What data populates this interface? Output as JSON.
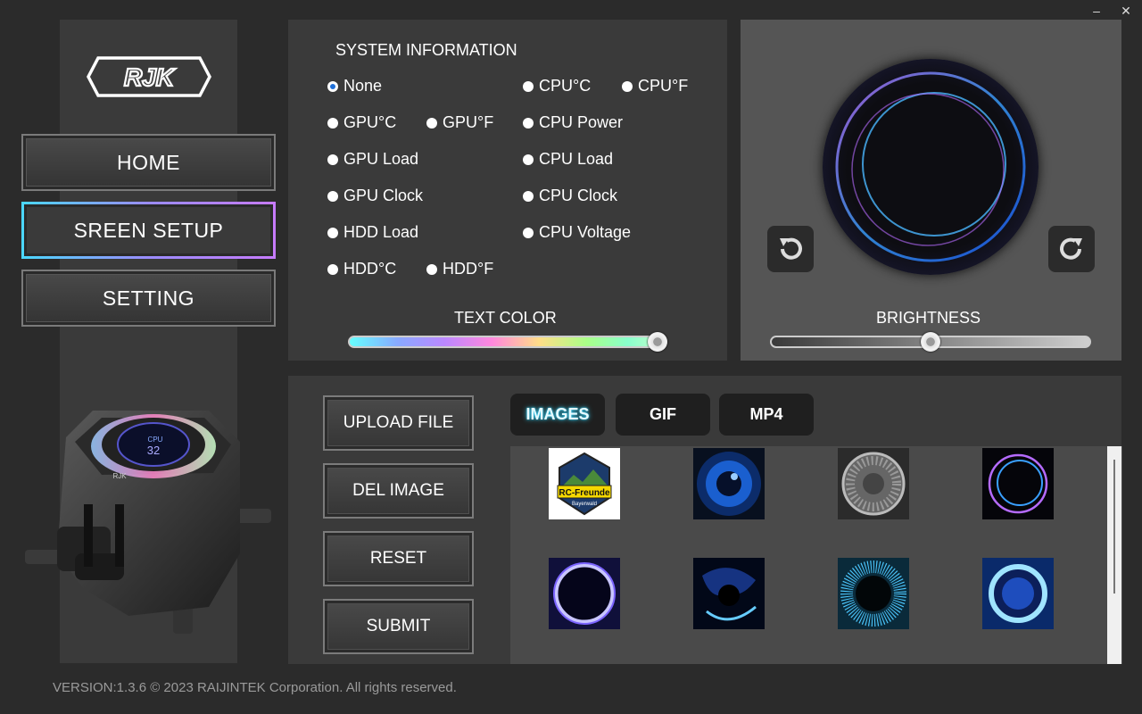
{
  "window": {
    "minimize_label": "–",
    "close_label": "✕"
  },
  "brand": {
    "logo_text": "RJK"
  },
  "nav": [
    {
      "label": "HOME"
    },
    {
      "label": "SREEN  SETUP"
    },
    {
      "label": "SETTING"
    }
  ],
  "device": {
    "screen_label": "CPU",
    "screen_value": "32",
    "cap_logo": "RJK"
  },
  "system_info": {
    "title": "SYSTEM INFORMATION",
    "selected": "None",
    "options": [
      "None",
      "CPU°C",
      "CPU°F",
      "GPU°C",
      "GPU°F",
      "CPU Power",
      "GPU Load",
      "CPU Load",
      "GPU Clock",
      "CPU Clock",
      "HDD Load",
      "CPU Voltage",
      "HDD°C",
      "HDD°F"
    ],
    "text_color_label": "TEXT COLOR",
    "text_color_value": 1.0
  },
  "preview": {
    "brightness_label": "BRIGHTNESS",
    "brightness_value": 0.5
  },
  "actions": {
    "upload": "UPLOAD FILE",
    "delete": "DEL IMAGE",
    "reset": "RESET",
    "submit": "SUBMIT"
  },
  "tabs": [
    {
      "label": "IMAGES",
      "active": true
    },
    {
      "label": "GIF",
      "active": false
    },
    {
      "label": "MP4",
      "active": false
    }
  ],
  "gallery": {
    "badge_text": "RC-Freunde",
    "badge_sub": "Bayerwald"
  },
  "footer": "VERSION:1.3.6 © 2023 RAIJINTEK Corporation. All rights reserved.",
  "colors": {
    "accent": "#37d7ff",
    "radio_selected": "#1e6fd9",
    "nav_active_border": "#9b8cff"
  }
}
